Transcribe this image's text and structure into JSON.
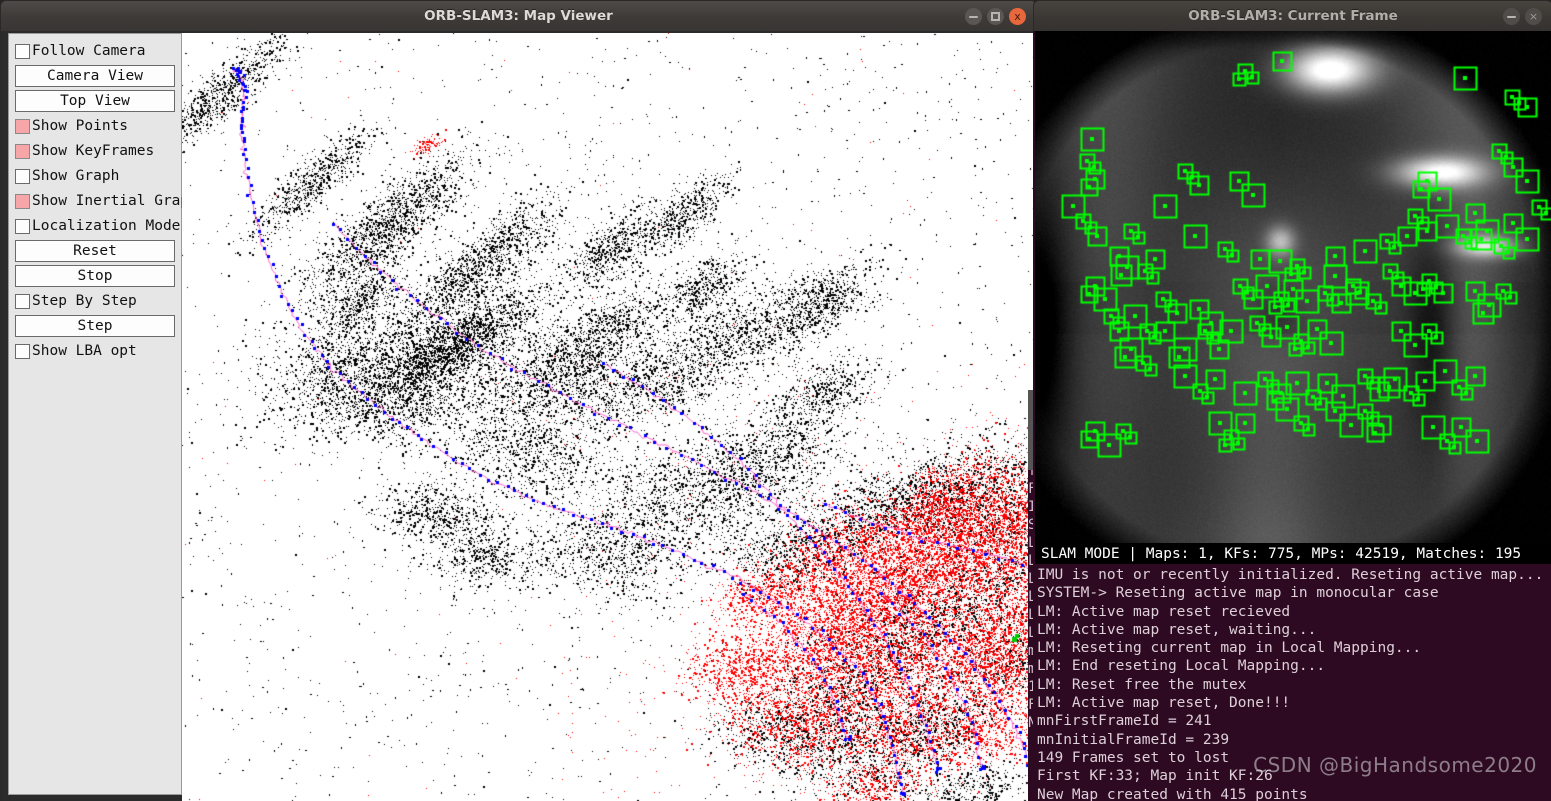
{
  "map_window": {
    "title": "ORB-SLAM3: Map Viewer",
    "buttons": {
      "minimize": "–",
      "maximize": "□",
      "close": "x"
    },
    "controls": [
      {
        "type": "checkbox",
        "label": "Follow Camera",
        "checked": false,
        "name": "follow-camera"
      },
      {
        "type": "button",
        "label": "Camera View",
        "name": "camera-view"
      },
      {
        "type": "button",
        "label": "Top View",
        "name": "top-view"
      },
      {
        "type": "checkbox",
        "label": "Show Points",
        "checked": true,
        "name": "show-points"
      },
      {
        "type": "checkbox",
        "label": "Show KeyFrames",
        "checked": true,
        "name": "show-keyframes"
      },
      {
        "type": "checkbox",
        "label": "Show Graph",
        "checked": false,
        "name": "show-graph"
      },
      {
        "type": "checkbox",
        "label": "Show Inertial Graph",
        "checked": true,
        "name": "show-inertial-graph"
      },
      {
        "type": "checkbox",
        "label": "Localization Mode",
        "checked": false,
        "name": "localization-mode"
      },
      {
        "type": "button",
        "label": "Reset",
        "name": "reset"
      },
      {
        "type": "button",
        "label": "Stop",
        "name": "stop"
      },
      {
        "type": "checkbox",
        "label": "Step By Step",
        "checked": false,
        "name": "step-by-step"
      },
      {
        "type": "button",
        "label": "Step",
        "name": "step"
      },
      {
        "type": "checkbox",
        "label": "Show LBA opt",
        "checked": false,
        "name": "show-lba-opt"
      }
    ],
    "viewport": {
      "point_colors": {
        "old_map": "#000000",
        "active_map": "#ff0000",
        "keyframe": "#0000ff",
        "trajectory": "#ff66cc",
        "current_camera": "#00cc00"
      },
      "background": "#ffffff"
    }
  },
  "frame_window": {
    "title": "ORB-SLAM3: Current Frame",
    "buttons": {
      "minimize": "–",
      "close": "×"
    },
    "feature_color": "#00ff00",
    "status_bar": "SLAM MODE |  Maps: 1, KFs: 775, MPs: 42519, Matches: 195",
    "status_values": {
      "mode": "SLAM MODE",
      "maps": 1,
      "kfs": 775,
      "mps": 42519,
      "matches": 195
    },
    "console_lines": [
      "IMU is not or recently initialized. Reseting active map...",
      "SYSTEM-> Reseting active map in monocular case",
      "LM: Active map reset recieved",
      "LM: Active map reset, waiting...",
      "LM: Reseting current map in Local Mapping...",
      "LM: End reseting Local Mapping...",
      "LM: Reset free the mutex",
      "LM: Active map reset, Done!!!",
      "mnFirstFrameId = 241",
      "mnInitialFrameId = 239",
      "149 Frames set to lost",
      "First KF:33; Map init KF:26",
      "New Map created with 415 points"
    ]
  },
  "background_terminal": {
    "visible_chars": [
      "1",
      "F",
      "N",
      "V",
      "f",
      "F",
      "I",
      "S",
      "L",
      "L",
      "L",
      "L",
      "L",
      "L",
      "m",
      "m",
      "1",
      "F",
      "N"
    ]
  },
  "watermark": "CSDN @BigHandsome2020"
}
